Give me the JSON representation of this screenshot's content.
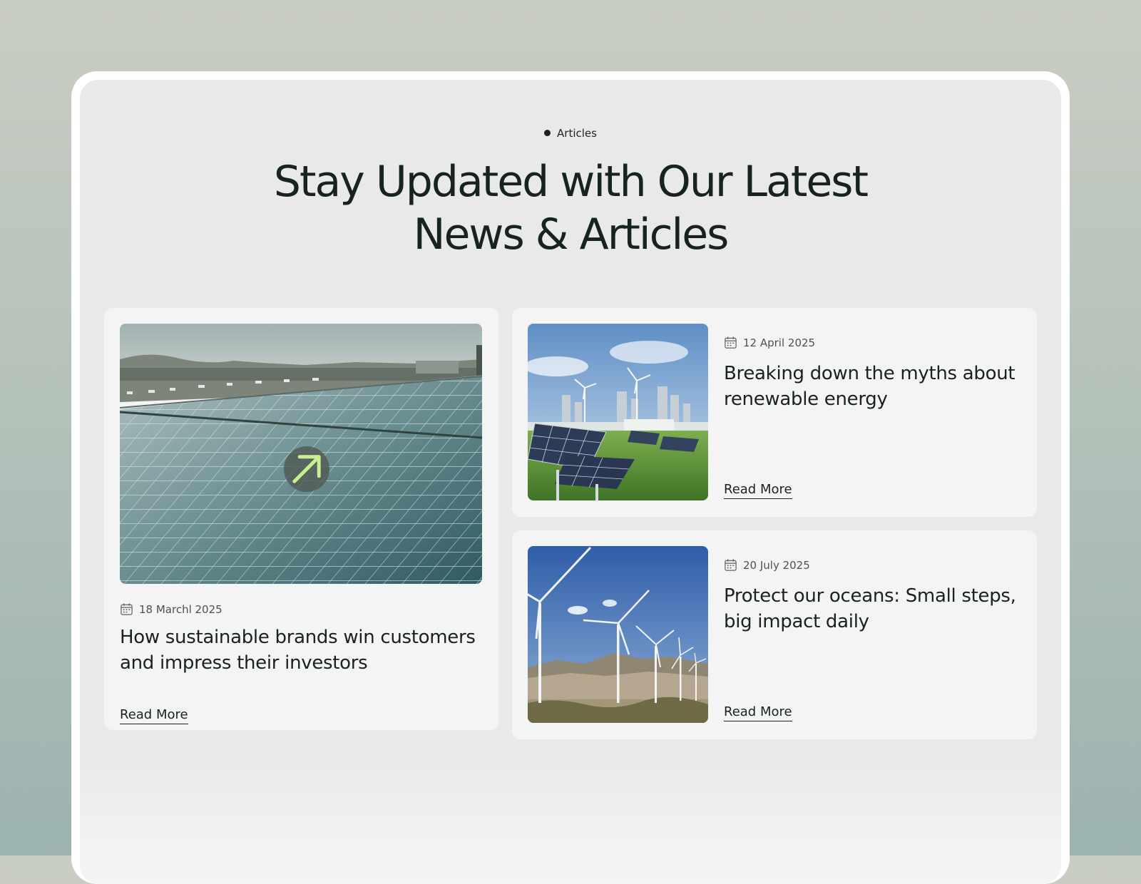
{
  "section": {
    "eyebrow": "Articles",
    "headline_line1": "Stay Updated with Our Latest",
    "headline_line2": "News & Articles"
  },
  "icons": {
    "calendar": "calendar-icon",
    "arrow": "arrow-up-right-icon"
  },
  "colors": {
    "text": "#172321",
    "card": "#f4f4f4",
    "panel": "#e9e9e9",
    "arrow_accent": "#c8f08f"
  },
  "articles": [
    {
      "date": "18 Marchl 2025",
      "title": "How sustainable brands win customers and impress their investors",
      "read_more": "Read More",
      "image": "solar panel field beside highway"
    },
    {
      "date": "12 April 2025",
      "title": "Breaking down the myths about renewable energy",
      "read_more": "Read More",
      "image": "solar panels and wind turbines before city skyline"
    },
    {
      "date": "20 July 2025",
      "title": "Protect our oceans: Small steps, big impact daily",
      "read_more": "Read More",
      "image": "wind turbines in desert"
    }
  ]
}
